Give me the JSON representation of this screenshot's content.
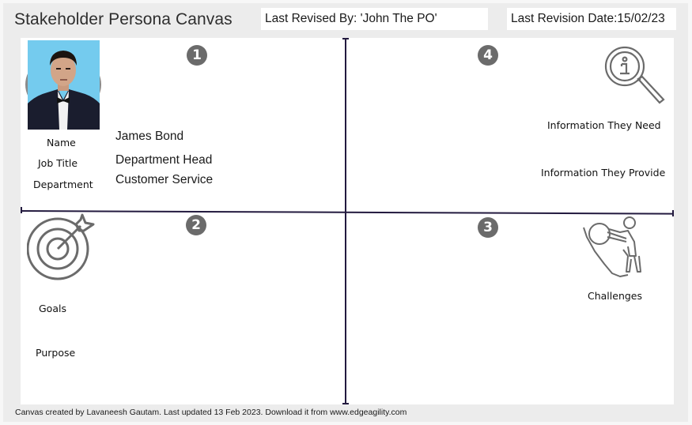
{
  "header": {
    "title": "Stakeholder Persona Canvas",
    "last_revised_by": "Last Revised By: 'John The PO'",
    "last_revision_date": "Last Revision Date:15/02/23"
  },
  "quadrants": [
    {
      "number": "1",
      "icon": "portrait-photo",
      "fields": [
        {
          "label": "Name",
          "value": "James Bond"
        },
        {
          "label": "Job Title",
          "value": "Department Head"
        },
        {
          "label": "Department",
          "value": "Customer Service"
        }
      ]
    },
    {
      "number": "2",
      "icon": "target-icon",
      "fields": [
        {
          "label": "Goals"
        },
        {
          "label": "Purpose"
        }
      ]
    },
    {
      "number": "3",
      "icon": "challenge-icon",
      "fields": [
        {
          "label": "Challenges"
        }
      ]
    },
    {
      "number": "4",
      "icon": "info-search-icon",
      "fields": [
        {
          "label": "Information They Need"
        },
        {
          "label": "Information They Provide"
        }
      ]
    }
  ],
  "footer": "Canvas created by Lavaneesh Gautam. Last updated 13 Feb 2023. Download it from www.edgeagility.com",
  "colors": {
    "axis": "#231a3f",
    "badge": "#6b6b6b",
    "icon": "#6b6b6b",
    "background": "#ececec"
  }
}
